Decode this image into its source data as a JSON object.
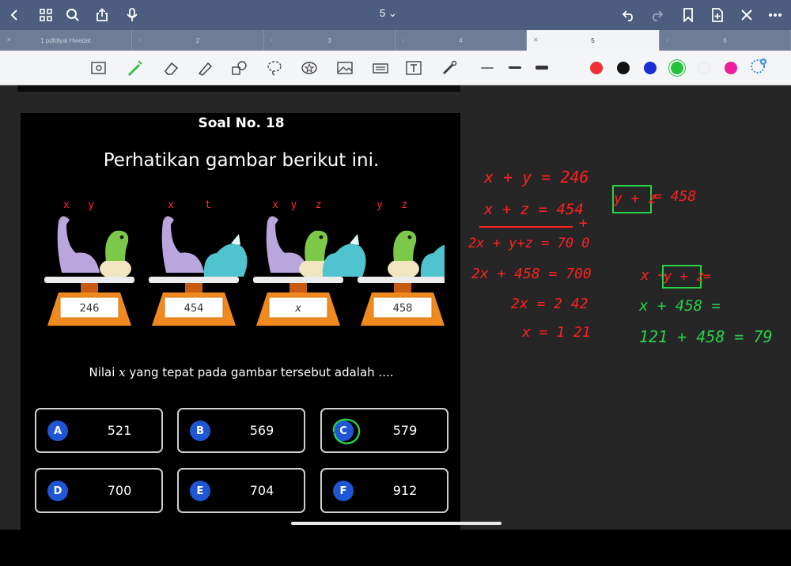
{
  "topbar": {
    "page_indicator": "5 ⌄",
    "icons": [
      "back-icon",
      "grid-icon",
      "search-icon",
      "share-icon",
      "mic-icon",
      "undo-icon",
      "redo-icon",
      "bookmark-icon",
      "add-page-icon",
      "close-icon",
      "more-icon"
    ]
  },
  "tabs": [
    {
      "label": "1 pdfdlyal Hwedat"
    },
    {
      "label": "2"
    },
    {
      "label": "3"
    },
    {
      "label": "4"
    },
    {
      "label": "5",
      "active": true
    },
    {
      "label": "6"
    }
  ],
  "toolbar": {
    "tools": [
      "lasso-select-icon",
      "pen-icon",
      "eraser-icon",
      "highlighter-icon",
      "shapes-icon",
      "lasso-icon",
      "sticker-icon",
      "image-icon",
      "camera-icon",
      "text-icon",
      "laser-pointer-icon"
    ],
    "colors": [
      "#f03030",
      "#111111",
      "#1a2fd6",
      "#22c43a",
      "#f3f4f6",
      "#f01ca0"
    ]
  },
  "quiz": {
    "title": "Soal No. 18",
    "instruction": "Perhatikan gambar berikut ini.",
    "scales": [
      {
        "labels": "x   y",
        "value": "246"
      },
      {
        "labels": "x     t",
        "value": "454"
      },
      {
        "labels": "x  y   z",
        "value": "x"
      },
      {
        "labels": "y   z",
        "value": "458"
      }
    ],
    "question_pre": "Nilai ",
    "question_var": "x",
    "question_post": " yang tepat pada gambar tersebut adalah ....",
    "options": [
      {
        "letter": "A",
        "value": "521"
      },
      {
        "letter": "B",
        "value": "569"
      },
      {
        "letter": "C",
        "value": "579"
      },
      {
        "letter": "D",
        "value": "700"
      },
      {
        "letter": "E",
        "value": "704"
      },
      {
        "letter": "F",
        "value": "912"
      }
    ]
  },
  "handwriting": {
    "red_lines": [
      "x + y = 246",
      "x + z = 454",
      "+",
      "2x + y+z = 70 0",
      "2x + 458 = 700",
      "2x = 2 42",
      "x = 1 21",
      "= 458"
    ],
    "green_boxed": [
      "y + z",
      "y + z"
    ],
    "green_lines": [
      "x +",
      "=",
      "x + 458 =",
      "121 + 458 =  79"
    ]
  }
}
